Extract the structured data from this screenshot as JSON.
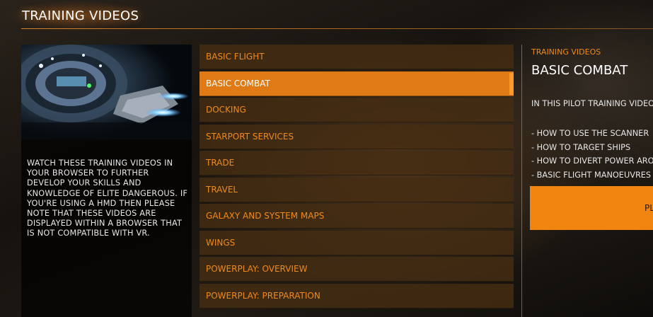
{
  "header": {
    "title": "TRAINING VIDEOS"
  },
  "left": {
    "thumbnail_icon": "space-station-thumbnail",
    "description": "WATCH THESE TRAINING VIDEOS IN YOUR BROWSER TO FURTHER DEVELOP YOUR SKILLS AND KNOWLEDGE OF ELITE DANGEROUS. IF YOU'RE USING A HMD THEN PLEASE NOTE THAT THESE VIDEOS ARE DISPLAYED WITHIN A BROWSER THAT IS NOT COMPATIBLE WITH VR."
  },
  "menu": {
    "items": [
      {
        "label": "BASIC FLIGHT",
        "selected": false
      },
      {
        "label": "BASIC COMBAT",
        "selected": true
      },
      {
        "label": "DOCKING",
        "selected": false
      },
      {
        "label": "STARPORT SERVICES",
        "selected": false
      },
      {
        "label": "TRADE",
        "selected": false
      },
      {
        "label": "TRAVEL",
        "selected": false
      },
      {
        "label": "GALAXY AND SYSTEM MAPS",
        "selected": false
      },
      {
        "label": "WINGS",
        "selected": false
      },
      {
        "label": "POWERPLAY: OVERVIEW",
        "selected": false
      },
      {
        "label": "POWERPLAY: PREPARATION",
        "selected": false
      }
    ]
  },
  "detail": {
    "kicker": "TRAINING VIDEOS",
    "title": "BASIC COMBAT",
    "intro": "IN THIS PILOT TRAINING VIDEO",
    "bullets": [
      "- HOW TO USE THE SCANNER",
      "- HOW TO TARGET SHIPS",
      "- HOW TO DIVERT POWER ARO",
      "- BASIC FLIGHT MANOEUVRES"
    ],
    "play_label": "PL"
  },
  "colors": {
    "accent": "#f08a1c",
    "selected_bg": "#e07a14",
    "button_bg": "#f28510",
    "item_bg": "#46300f"
  }
}
